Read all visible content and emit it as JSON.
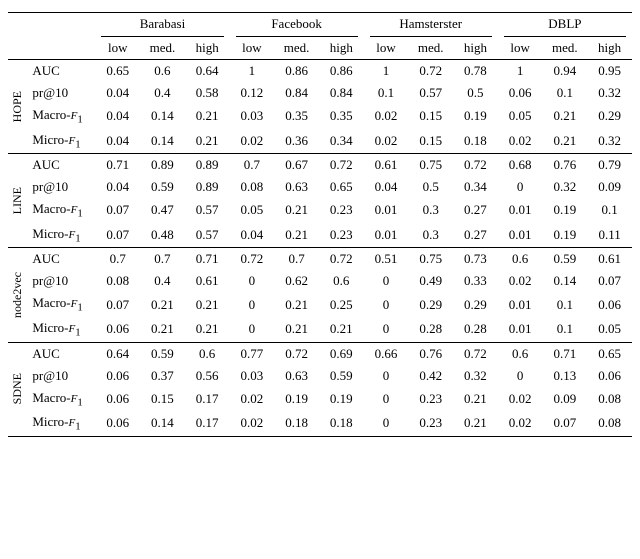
{
  "datasets": [
    "Barabasi",
    "Facebook",
    "Hamsterster",
    "DBLP"
  ],
  "levels": [
    "low",
    "med.",
    "high"
  ],
  "methods": [
    {
      "name": "HOPE",
      "rows": [
        {
          "metric": "AUC",
          "values": [
            "0.65",
            "0.6",
            "0.64",
            "1",
            "0.86",
            "0.86",
            "1",
            "0.72",
            "0.78",
            "1",
            "0.94",
            "0.95"
          ]
        },
        {
          "metric": "pr@10",
          "values": [
            "0.04",
            "0.4",
            "0.58",
            "0.12",
            "0.84",
            "0.84",
            "0.1",
            "0.57",
            "0.5",
            "0.06",
            "0.1",
            "0.32"
          ]
        },
        {
          "metric": "Macro-F1",
          "values": [
            "0.04",
            "0.14",
            "0.21",
            "0.03",
            "0.35",
            "0.35",
            "0.02",
            "0.15",
            "0.19",
            "0.05",
            "0.21",
            "0.29"
          ]
        },
        {
          "metric": "Micro-F1",
          "values": [
            "0.04",
            "0.14",
            "0.21",
            "0.02",
            "0.36",
            "0.34",
            "0.02",
            "0.15",
            "0.18",
            "0.02",
            "0.21",
            "0.32"
          ]
        }
      ]
    },
    {
      "name": "LINE",
      "rows": [
        {
          "metric": "AUC",
          "values": [
            "0.71",
            "0.89",
            "0.89",
            "0.7",
            "0.67",
            "0.72",
            "0.61",
            "0.75",
            "0.72",
            "0.68",
            "0.76",
            "0.79"
          ]
        },
        {
          "metric": "pr@10",
          "values": [
            "0.04",
            "0.59",
            "0.89",
            "0.08",
            "0.63",
            "0.65",
            "0.04",
            "0.5",
            "0.34",
            "0",
            "0.32",
            "0.09"
          ]
        },
        {
          "metric": "Macro-F1",
          "values": [
            "0.07",
            "0.47",
            "0.57",
            "0.05",
            "0.21",
            "0.23",
            "0.01",
            "0.3",
            "0.27",
            "0.01",
            "0.19",
            "0.1"
          ]
        },
        {
          "metric": "Micro-F1",
          "values": [
            "0.07",
            "0.48",
            "0.57",
            "0.04",
            "0.21",
            "0.23",
            "0.01",
            "0.3",
            "0.27",
            "0.01",
            "0.19",
            "0.11"
          ]
        }
      ]
    },
    {
      "name": "node2vec",
      "rows": [
        {
          "metric": "AUC",
          "values": [
            "0.7",
            "0.7",
            "0.71",
            "0.72",
            "0.7",
            "0.72",
            "0.51",
            "0.75",
            "0.73",
            "0.6",
            "0.59",
            "0.61"
          ]
        },
        {
          "metric": "pr@10",
          "values": [
            "0.08",
            "0.4",
            "0.61",
            "0",
            "0.62",
            "0.6",
            "0",
            "0.49",
            "0.33",
            "0.02",
            "0.14",
            "0.07"
          ]
        },
        {
          "metric": "Macro-F1",
          "values": [
            "0.07",
            "0.21",
            "0.21",
            "0",
            "0.21",
            "0.25",
            "0",
            "0.29",
            "0.29",
            "0.01",
            "0.1",
            "0.06"
          ]
        },
        {
          "metric": "Micro-F1",
          "values": [
            "0.06",
            "0.21",
            "0.21",
            "0",
            "0.21",
            "0.21",
            "0",
            "0.28",
            "0.28",
            "0.01",
            "0.1",
            "0.05"
          ]
        }
      ]
    },
    {
      "name": "SDNE",
      "rows": [
        {
          "metric": "AUC",
          "values": [
            "0.64",
            "0.59",
            "0.6",
            "0.77",
            "0.72",
            "0.69",
            "0.66",
            "0.76",
            "0.72",
            "0.6",
            "0.71",
            "0.65"
          ]
        },
        {
          "metric": "pr@10",
          "values": [
            "0.06",
            "0.37",
            "0.56",
            "0.03",
            "0.63",
            "0.59",
            "0",
            "0.42",
            "0.32",
            "0",
            "0.13",
            "0.06"
          ]
        },
        {
          "metric": "Macro-F1",
          "values": [
            "0.06",
            "0.15",
            "0.17",
            "0.02",
            "0.19",
            "0.19",
            "0",
            "0.23",
            "0.21",
            "0.02",
            "0.09",
            "0.08"
          ]
        },
        {
          "metric": "Micro-F1",
          "values": [
            "0.06",
            "0.14",
            "0.17",
            "0.02",
            "0.18",
            "0.18",
            "0",
            "0.23",
            "0.21",
            "0.02",
            "0.07",
            "0.08"
          ]
        }
      ]
    }
  ],
  "chart_data": {
    "type": "table",
    "title": "",
    "columns": {
      "datasets": [
        "Barabasi",
        "Facebook",
        "Hamsterster",
        "DBLP"
      ],
      "levels": [
        "low",
        "med.",
        "high"
      ]
    },
    "rows": [
      {
        "method": "HOPE",
        "metric": "AUC",
        "Barabasi": {
          "low": 0.65,
          "med.": 0.6,
          "high": 0.64
        },
        "Facebook": {
          "low": 1,
          "med.": 0.86,
          "high": 0.86
        },
        "Hamsterster": {
          "low": 1,
          "med.": 0.72,
          "high": 0.78
        },
        "DBLP": {
          "low": 1,
          "med.": 0.94,
          "high": 0.95
        }
      },
      {
        "method": "HOPE",
        "metric": "pr@10",
        "Barabasi": {
          "low": 0.04,
          "med.": 0.4,
          "high": 0.58
        },
        "Facebook": {
          "low": 0.12,
          "med.": 0.84,
          "high": 0.84
        },
        "Hamsterster": {
          "low": 0.1,
          "med.": 0.57,
          "high": 0.5
        },
        "DBLP": {
          "low": 0.06,
          "med.": 0.1,
          "high": 0.32
        }
      },
      {
        "method": "HOPE",
        "metric": "Macro-F1",
        "Barabasi": {
          "low": 0.04,
          "med.": 0.14,
          "high": 0.21
        },
        "Facebook": {
          "low": 0.03,
          "med.": 0.35,
          "high": 0.35
        },
        "Hamsterster": {
          "low": 0.02,
          "med.": 0.15,
          "high": 0.19
        },
        "DBLP": {
          "low": 0.05,
          "med.": 0.21,
          "high": 0.29
        }
      },
      {
        "method": "HOPE",
        "metric": "Micro-F1",
        "Barabasi": {
          "low": 0.04,
          "med.": 0.14,
          "high": 0.21
        },
        "Facebook": {
          "low": 0.02,
          "med.": 0.36,
          "high": 0.34
        },
        "Hamsterster": {
          "low": 0.02,
          "med.": 0.15,
          "high": 0.18
        },
        "DBLP": {
          "low": 0.02,
          "med.": 0.21,
          "high": 0.32
        }
      },
      {
        "method": "LINE",
        "metric": "AUC",
        "Barabasi": {
          "low": 0.71,
          "med.": 0.89,
          "high": 0.89
        },
        "Facebook": {
          "low": 0.7,
          "med.": 0.67,
          "high": 0.72
        },
        "Hamsterster": {
          "low": 0.61,
          "med.": 0.75,
          "high": 0.72
        },
        "DBLP": {
          "low": 0.68,
          "med.": 0.76,
          "high": 0.79
        }
      },
      {
        "method": "LINE",
        "metric": "pr@10",
        "Barabasi": {
          "low": 0.04,
          "med.": 0.59,
          "high": 0.89
        },
        "Facebook": {
          "low": 0.08,
          "med.": 0.63,
          "high": 0.65
        },
        "Hamsterster": {
          "low": 0.04,
          "med.": 0.5,
          "high": 0.34
        },
        "DBLP": {
          "low": 0,
          "med.": 0.32,
          "high": 0.09
        }
      },
      {
        "method": "LINE",
        "metric": "Macro-F1",
        "Barabasi": {
          "low": 0.07,
          "med.": 0.47,
          "high": 0.57
        },
        "Facebook": {
          "low": 0.05,
          "med.": 0.21,
          "high": 0.23
        },
        "Hamsterster": {
          "low": 0.01,
          "med.": 0.3,
          "high": 0.27
        },
        "DBLP": {
          "low": 0.01,
          "med.": 0.19,
          "high": 0.1
        }
      },
      {
        "method": "LINE",
        "metric": "Micro-F1",
        "Barabasi": {
          "low": 0.07,
          "med.": 0.48,
          "high": 0.57
        },
        "Facebook": {
          "low": 0.04,
          "med.": 0.21,
          "high": 0.23
        },
        "Hamsterster": {
          "low": 0.01,
          "med.": 0.3,
          "high": 0.27
        },
        "DBLP": {
          "low": 0.01,
          "med.": 0.19,
          "high": 0.11
        }
      },
      {
        "method": "node2vec",
        "metric": "AUC",
        "Barabasi": {
          "low": 0.7,
          "med.": 0.7,
          "high": 0.71
        },
        "Facebook": {
          "low": 0.72,
          "med.": 0.7,
          "high": 0.72
        },
        "Hamsterster": {
          "low": 0.51,
          "med.": 0.75,
          "high": 0.73
        },
        "DBLP": {
          "low": 0.6,
          "med.": 0.59,
          "high": 0.61
        }
      },
      {
        "method": "node2vec",
        "metric": "pr@10",
        "Barabasi": {
          "low": 0.08,
          "med.": 0.4,
          "high": 0.61
        },
        "Facebook": {
          "low": 0,
          "med.": 0.62,
          "high": 0.6
        },
        "Hamsterster": {
          "low": 0,
          "med.": 0.49,
          "high": 0.33
        },
        "DBLP": {
          "low": 0.02,
          "med.": 0.14,
          "high": 0.07
        }
      },
      {
        "method": "node2vec",
        "metric": "Macro-F1",
        "Barabasi": {
          "low": 0.07,
          "med.": 0.21,
          "high": 0.21
        },
        "Facebook": {
          "low": 0,
          "med.": 0.21,
          "high": 0.25
        },
        "Hamsterster": {
          "low": 0,
          "med.": 0.29,
          "high": 0.29
        },
        "DBLP": {
          "low": 0.01,
          "med.": 0.1,
          "high": 0.06
        }
      },
      {
        "method": "node2vec",
        "metric": "Micro-F1",
        "Barabasi": {
          "low": 0.06,
          "med.": 0.21,
          "high": 0.21
        },
        "Facebook": {
          "low": 0,
          "med.": 0.21,
          "high": 0.21
        },
        "Hamsterster": {
          "low": 0,
          "med.": 0.28,
          "high": 0.28
        },
        "DBLP": {
          "low": 0.01,
          "med.": 0.1,
          "high": 0.05
        }
      },
      {
        "method": "SDNE",
        "metric": "AUC",
        "Barabasi": {
          "low": 0.64,
          "med.": 0.59,
          "high": 0.6
        },
        "Facebook": {
          "low": 0.77,
          "med.": 0.72,
          "high": 0.69
        },
        "Hamsterster": {
          "low": 0.66,
          "med.": 0.76,
          "high": 0.72
        },
        "DBLP": {
          "low": 0.6,
          "med.": 0.71,
          "high": 0.65
        }
      },
      {
        "method": "SDNE",
        "metric": "pr@10",
        "Barabasi": {
          "low": 0.06,
          "med.": 0.37,
          "high": 0.56
        },
        "Facebook": {
          "low": 0.03,
          "med.": 0.63,
          "high": 0.59
        },
        "Hamsterster": {
          "low": 0,
          "med.": 0.42,
          "high": 0.32
        },
        "DBLP": {
          "low": 0,
          "med.": 0.13,
          "high": 0.06
        }
      },
      {
        "method": "SDNE",
        "metric": "Macro-F1",
        "Barabasi": {
          "low": 0.06,
          "med.": 0.15,
          "high": 0.17
        },
        "Facebook": {
          "low": 0.02,
          "med.": 0.19,
          "high": 0.19
        },
        "Hamsterster": {
          "low": 0,
          "med.": 0.23,
          "high": 0.21
        },
        "DBLP": {
          "low": 0.02,
          "med.": 0.09,
          "high": 0.08
        }
      },
      {
        "method": "SDNE",
        "metric": "Micro-F1",
        "Barabasi": {
          "low": 0.06,
          "med.": 0.14,
          "high": 0.17
        },
        "Facebook": {
          "low": 0.02,
          "med.": 0.18,
          "high": 0.18
        },
        "Hamsterster": {
          "low": 0,
          "med.": 0.23,
          "high": 0.21
        },
        "DBLP": {
          "low": 0.02,
          "med.": 0.07,
          "high": 0.08
        }
      }
    ]
  }
}
